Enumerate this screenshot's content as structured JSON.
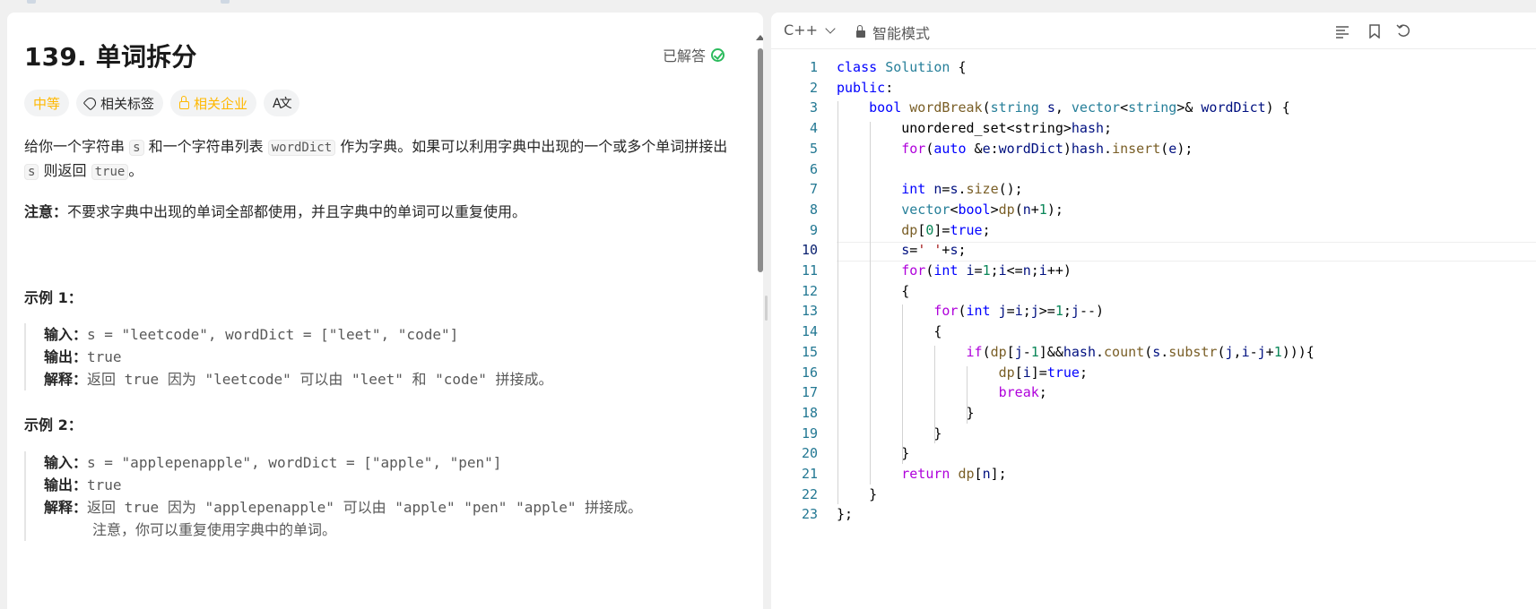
{
  "problem": {
    "title": "139. 单词拆分",
    "solved_label": "已解答",
    "tags": {
      "difficulty": "中等",
      "topics": "相关标签",
      "companies": "相关企业",
      "translate": "A文"
    },
    "desc": {
      "p1_a": "给你一个字符串 ",
      "p1_code1": "s",
      "p1_b": " 和一个字符串列表 ",
      "p1_code2": "wordDict",
      "p1_c": " 作为字典。如果可以利用字典中出现的一个或多个单词拼接出 ",
      "p1_code3": "s",
      "p1_d": " 则返回 ",
      "p1_code4": "true",
      "p1_e": "。",
      "note_label": "注意：",
      "note_text": "不要求字典中出现的单词全部都使用，并且字典中的单词可以重复使用。"
    },
    "examples": [
      {
        "heading": "示例 1：",
        "input_label": "输入：",
        "input": "s = \"leetcode\", wordDict = [\"leet\", \"code\"]",
        "output_label": "输出：",
        "output": "true",
        "explain_label": "解释：",
        "explain": "返回 true 因为 \"leetcode\" 可以由 \"leet\" 和 \"code\" 拼接成。",
        "explain2": ""
      },
      {
        "heading": "示例 2：",
        "input_label": "输入：",
        "input": "s = \"applepenapple\", wordDict = [\"apple\", \"pen\"]",
        "output_label": "输出：",
        "output": "true",
        "explain_label": "解释：",
        "explain": "返回 true 因为 \"applepenapple\" 可以由 \"apple\" \"pen\" \"apple\" 拼接成。",
        "explain2": "注意，你可以重复使用字典中的单词。"
      }
    ]
  },
  "editor": {
    "language": "C++",
    "mode": "智能模式",
    "current_line": 10,
    "line_numbers": [
      "1",
      "2",
      "3",
      "4",
      "5",
      "6",
      "7",
      "8",
      "9",
      "10",
      "11",
      "12",
      "13",
      "14",
      "15",
      "16",
      "17",
      "18",
      "19",
      "20",
      "21",
      "22",
      "23"
    ],
    "code_lines": [
      "class Solution {",
      "public:",
      "    bool wordBreak(string s, vector<string>& wordDict) {",
      "        unordered_set<string>hash;",
      "        for(auto &e:wordDict)hash.insert(e);",
      "",
      "        int n=s.size();",
      "        vector<bool>dp(n+1);",
      "        dp[0]=true;",
      "        s=' '+s;",
      "        for(int i=1;i<=n;i++)",
      "        {",
      "            for(int j=i;j>=1;j--)",
      "            {",
      "                if(dp[j-1]&&hash.count(s.substr(j,i-j+1))){",
      "                    dp[i]=true;",
      "                    break;",
      "                }",
      "            }",
      "        }",
      "        return dp[n];",
      "    }",
      "};"
    ]
  },
  "icons": {
    "toolbar": [
      "format-icon",
      "bookmark-icon",
      "reset-icon"
    ]
  }
}
